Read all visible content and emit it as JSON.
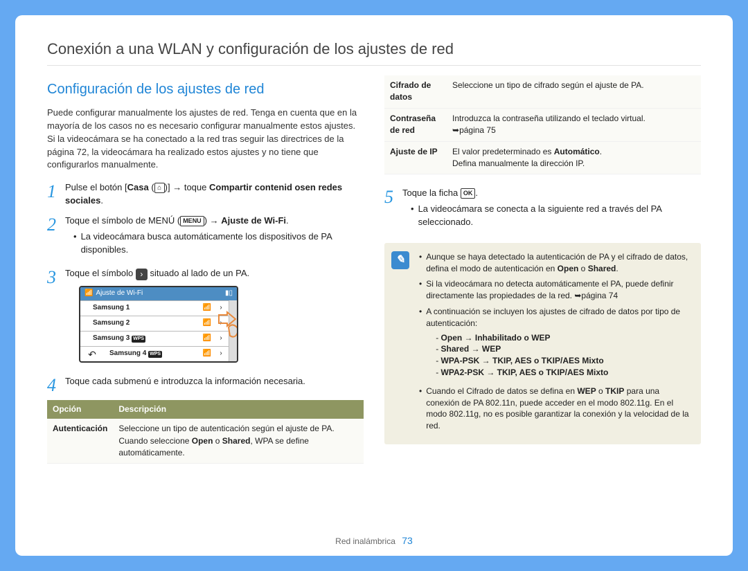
{
  "title": "Conexión a una WLAN y configuración de los ajustes de red",
  "section_title": "Configuración de los ajustes de red",
  "intro": "Puede configurar manualmente los ajustes de red. Tenga en cuenta que en la mayoría de los casos no es necesario configurar manualmente estos ajustes. Si la videocámara se ha conectado a la red tras seguir las directrices de la página 72, la videocámara ha realizado estos ajustes y no tiene que configurarlos manualmente.",
  "steps": {
    "s1_a": "Pulse el botón [",
    "s1_b": "Casa",
    "s1_c": " (",
    "s1_d": ")] ",
    "s1_e": " toque ",
    "s1_f": "Compartir contenid osen redes sociales",
    "s1_g": ".",
    "s2_a": "Toque el símbolo de MENÚ (",
    "s2_b": ") ",
    "s2_c": " ",
    "s2_d": "Ajuste de Wi-Fi",
    "s2_e": ".",
    "s2_sub": "La videocámara busca automáticamente los dispositivos de PA disponibles.",
    "s3_a": "Toque el símbolo ",
    "s3_b": " situado al lado de un PA.",
    "s4": "Toque cada submenú e introduzca la información necesaria.",
    "s5_a": "Toque la ficha ",
    "s5_b": ".",
    "s5_sub": "La videocámara se conecta a la siguiente red a través del PA seleccionado."
  },
  "nums": {
    "n1": "1",
    "n2": "2",
    "n3": "3",
    "n4": "4",
    "n5": "5"
  },
  "menu_label": "MENU",
  "ok_label": "OK",
  "device": {
    "title": "Ajuste de Wi-Fi",
    "r1": "Samsung 1",
    "r2": "Samsung 2",
    "r3": "Samsung 3",
    "r4": "Samsung 4",
    "wps": "WPS"
  },
  "table": {
    "h1": "Opción",
    "h2": "Descripción",
    "r1_opt": "Autenticación",
    "r1_desc_a": "Seleccione un tipo de autenticación según el ajuste de PA. Cuando seleccione ",
    "r1_desc_b": "Open",
    "r1_desc_c": " o ",
    "r1_desc_d": "Shared",
    "r1_desc_e": ", WPA se define automáticamente.",
    "r2_opt": "Cifrado de datos",
    "r2_desc": "Seleccione un tipo de cifrado según el ajuste de PA.",
    "r3_opt": "Contraseña de red",
    "r3_desc_a": "Introduzca la contraseña utilizando el teclado virtual. ",
    "r3_desc_b": "página 75",
    "r4_opt": "Ajuste de IP",
    "r4_desc_a": "El valor predeterminado es ",
    "r4_desc_b": "Automático",
    "r4_desc_c": ".",
    "r4_desc_d": "Defina manualmente la dirección IP."
  },
  "note": {
    "b1_a": "Aunque se haya detectado la autenticación de PA y el cifrado de datos, defina el modo de autenticación en ",
    "b1_b": "Open",
    "b1_c": " o ",
    "b1_d": "Shared",
    "b1_e": ".",
    "b2_a": "Si la videocámara no detecta automáticamente el PA, puede definir directamente las propiedades de la red. ",
    "b2_b": "página 74",
    "b3": "A continuación se incluyen los ajustes de cifrado de datos por tipo de autenticación:",
    "d1": "Open → Inhabilitado o WEP",
    "d2": "Shared → WEP",
    "d3": "WPA-PSK → TKIP, AES o TKIP/AES Mixto",
    "d4": "WPA2-PSK → TKIP, AES o TKIP/AES Mixto",
    "b4_a": "Cuando el Cifrado de datos se defina en ",
    "b4_b": "WEP",
    "b4_c": " o ",
    "b4_d": "TKIP",
    "b4_e": " para una conexión de PA 802.11n, puede acceder en el modo 802.11g. En el modo 802.11g, no es posible garantizar la conexión y la velocidad de la red."
  },
  "footer": {
    "section": "Red inalámbrica",
    "page": "73"
  }
}
